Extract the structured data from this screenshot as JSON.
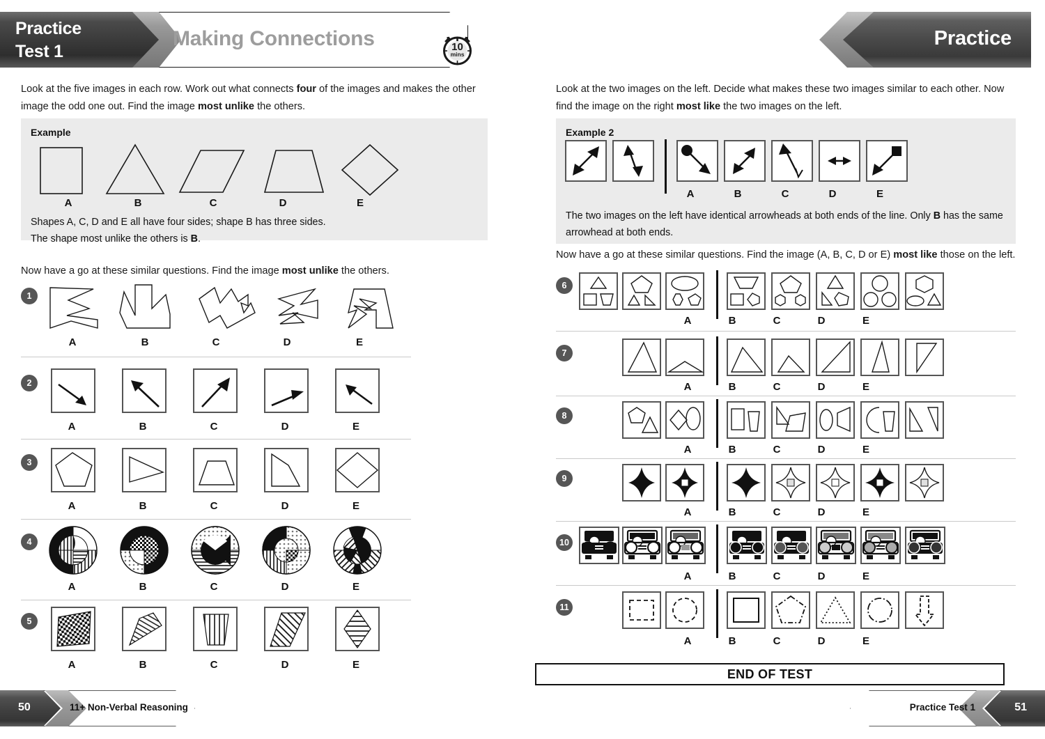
{
  "header": {
    "practice_line1": "Practice",
    "practice_line2": "Test 1",
    "section_title": "Making Connections",
    "timer_value": "10",
    "timer_unit": "mins",
    "right_label": "Practice"
  },
  "left_page": {
    "intro": "Look at the five images in each row. Work out what connects four of the images and makes the other image the odd one out. Find the image most unlike the others.",
    "intro_bold_1": "four",
    "intro_bold_2": "most unlike",
    "example": {
      "title": "Example",
      "option_labels": [
        "A",
        "B",
        "C",
        "D",
        "E"
      ],
      "shapes": [
        "square",
        "triangle",
        "parallelogram",
        "trapezium",
        "diamond"
      ],
      "explanation_line1": "Shapes A, C, D and E all have four sides; shape B has three sides.",
      "explanation_line2": "The shape most unlike the others is B.",
      "answer": "B"
    },
    "prompt": "Now have a go at these similar questions. Find the image most unlike the others.",
    "prompt_bold": "most unlike",
    "questions": [
      {
        "number": "1",
        "option_labels": [
          "A",
          "B",
          "C",
          "D",
          "E"
        ],
        "kind": "irregular-polygons"
      },
      {
        "number": "2",
        "option_labels": [
          "A",
          "B",
          "C",
          "D",
          "E"
        ],
        "kind": "arrows-in-boxes"
      },
      {
        "number": "3",
        "option_labels": [
          "A",
          "B",
          "C",
          "D",
          "E"
        ],
        "kind": "shapes-in-boxes"
      },
      {
        "number": "4",
        "option_labels": [
          "A",
          "B",
          "C",
          "D",
          "E"
        ],
        "kind": "patterned-circles"
      },
      {
        "number": "5",
        "option_labels": [
          "A",
          "B",
          "C",
          "D",
          "E"
        ],
        "kind": "patterned-quadrilaterals"
      }
    ]
  },
  "right_page": {
    "intro": "Look at the two images on the left. Decide what makes these two images similar to each other. Now find the image on the right most like the two images on the left.",
    "intro_bold": "most like",
    "example": {
      "title": "Example 2",
      "option_labels": [
        "A",
        "B",
        "C",
        "D",
        "E"
      ],
      "explanation_line1": "The two images on the left have identical arrowheads at both ends of the line. Only B has the same",
      "explanation_line2": "arrowhead at both ends.",
      "answer": "B"
    },
    "prompt": "Now have a go at these similar questions. Find the image (A, B, C, D or E) most like those on the left.",
    "prompt_bold": "most like",
    "questions": [
      {
        "number": "6",
        "option_labels": [
          "A",
          "B",
          "C",
          "D",
          "E"
        ],
        "kind": "shape-groups"
      },
      {
        "number": "7",
        "option_labels": [
          "A",
          "B",
          "C",
          "D",
          "E"
        ],
        "kind": "triangles"
      },
      {
        "number": "8",
        "option_labels": [
          "A",
          "B",
          "C",
          "D",
          "E"
        ],
        "kind": "shape-pairs"
      },
      {
        "number": "9",
        "option_labels": [
          "A",
          "B",
          "C",
          "D",
          "E"
        ],
        "kind": "four-point-stars"
      },
      {
        "number": "10",
        "option_labels": [
          "A",
          "B",
          "C",
          "D",
          "E"
        ],
        "kind": "trucks"
      },
      {
        "number": "11",
        "option_labels": [
          "A",
          "B",
          "C",
          "D",
          "E"
        ],
        "kind": "dashed-outlines"
      }
    ],
    "end_of_test": "END OF TEST"
  },
  "footer": {
    "left_page_number": "50",
    "left_text": "11+ Non-Verbal Reasoning",
    "right_page_number": "51",
    "right_text": "Practice Test 1"
  }
}
